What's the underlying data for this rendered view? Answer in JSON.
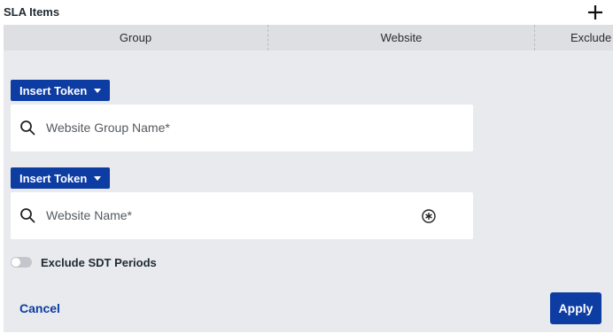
{
  "header": {
    "title": "SLA Items",
    "add_icon": "plus-icon"
  },
  "table": {
    "columns": [
      "Group",
      "Website",
      "Exclude"
    ]
  },
  "form": {
    "group_token_label": "Insert Token",
    "group_field_placeholder": "Website Group Name*",
    "website_token_label": "Insert Token",
    "website_field_placeholder": "Website Name*",
    "exclude_sdt_label": "Exclude SDT Periods",
    "exclude_sdt_on": false
  },
  "actions": {
    "cancel_label": "Cancel",
    "apply_label": "Apply"
  },
  "colors": {
    "accent": "#0d3ca3",
    "panel": "#e9eaed",
    "column_header": "#dedfe2"
  }
}
